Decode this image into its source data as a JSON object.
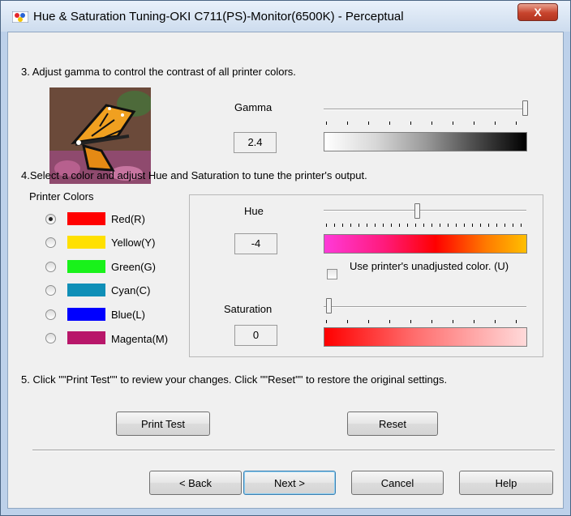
{
  "window": {
    "title": "Hue & Saturation Tuning-OKI C711(PS)-Monitor(6500K) - Perceptual",
    "close_glyph": "X"
  },
  "gamma_section": {
    "instruction": "3. Adjust gamma to control the contrast of all printer colors.",
    "slider_label": "Gamma",
    "value": "2.4",
    "slider_level": 1.0,
    "gradient": "white-to-black",
    "image_icon": "butterfly-photo"
  },
  "hue_sat_section": {
    "instruction": "4.Select a color and adjust Hue and Saturation to tune the printer's output.",
    "colors_label": "Printer Colors",
    "colors": [
      {
        "label": "Red(R)",
        "color": "#ff0000",
        "selected": true
      },
      {
        "label": "Yellow(Y)",
        "color": "#ffe000",
        "selected": false
      },
      {
        "label": "Green(G)",
        "color": "#19f21a",
        "selected": false
      },
      {
        "label": "Cyan(C)",
        "color": "#0f8fb7",
        "selected": false
      },
      {
        "label": "Blue(L)",
        "color": "#0000ff",
        "selected": false
      },
      {
        "label": "Magenta(M)",
        "color": "#b8176a",
        "selected": false
      }
    ],
    "hue_label": "Hue",
    "hue_value": "-4",
    "hue_slider_level": 0.47,
    "hue_gradient": [
      "#ff3ad9",
      "#ff0000",
      "#ffbf00"
    ],
    "unadjusted_label": "Use printer's unadjusted color. (U)",
    "unadjusted_checked": false,
    "saturation_label": "Saturation",
    "saturation_value": "0",
    "saturation_slider_level": 0.0,
    "saturation_gradient": [
      "#ff0000",
      "#ffdada"
    ]
  },
  "test_section": {
    "instruction": "5. Click \"\"Print Test\"\" to review your changes. Click \"\"Reset\"\" to restore the original settings.",
    "print_test_label": "Print Test",
    "reset_label": "Reset"
  },
  "footer": {
    "back_label": "< Back",
    "next_label": "Next >",
    "cancel_label": "Cancel",
    "help_label": "Help"
  }
}
